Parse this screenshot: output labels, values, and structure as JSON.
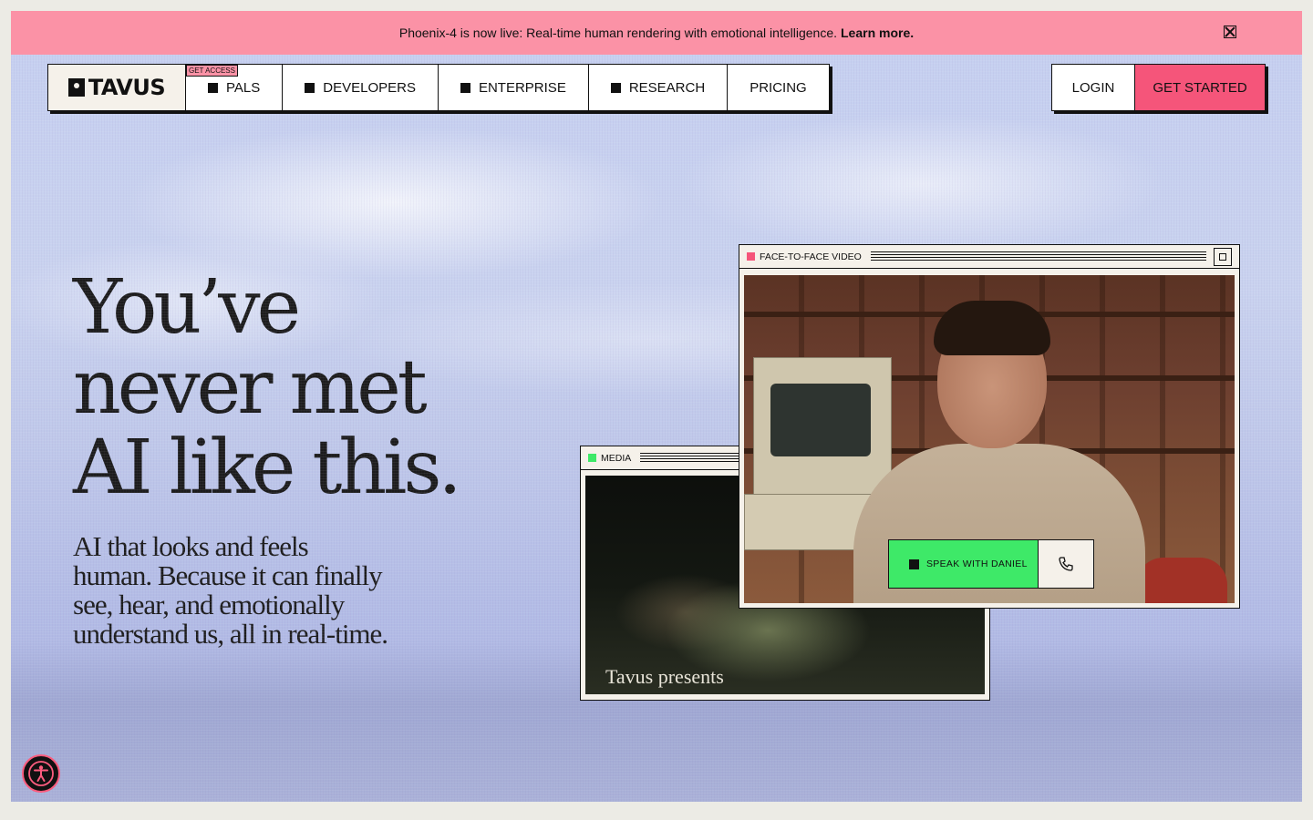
{
  "banner": {
    "message": "Phoenix-4 is now live: Real-time human rendering with emotional intelligence.",
    "link": "Learn more.",
    "close_icon": "close-icon"
  },
  "nav": {
    "logo": "TAVUS",
    "items": [
      {
        "label": "PALS",
        "tag": "GET ACCESS",
        "icon": true
      },
      {
        "label": "DEVELOPERS",
        "icon": true
      },
      {
        "label": "ENTERPRISE",
        "icon": true
      },
      {
        "label": "RESEARCH",
        "icon": true
      },
      {
        "label": "PRICING",
        "icon": false
      }
    ],
    "login": "LOGIN",
    "get_started": "GET STARTED"
  },
  "hero": {
    "headline_lines": [
      "You’ve",
      "never met",
      "AI like this."
    ],
    "subhead": "AI that looks and feels human. Because it can finally see, hear, and emotionally understand us, all in real-time."
  },
  "media_window": {
    "title": "MEDIA",
    "caption": "Tavus presents",
    "indicator_color": "#3ee968"
  },
  "video_window": {
    "title": "FACE-TO-FACE VIDEO",
    "indicator_color": "#f5557a",
    "speak_button": "SPEAK WITH DANIEL"
  },
  "colors": {
    "banner": "#fb92a6",
    "cta": "#f5557a",
    "speak_green": "#3ee968",
    "paper": "#f5f1ea"
  }
}
